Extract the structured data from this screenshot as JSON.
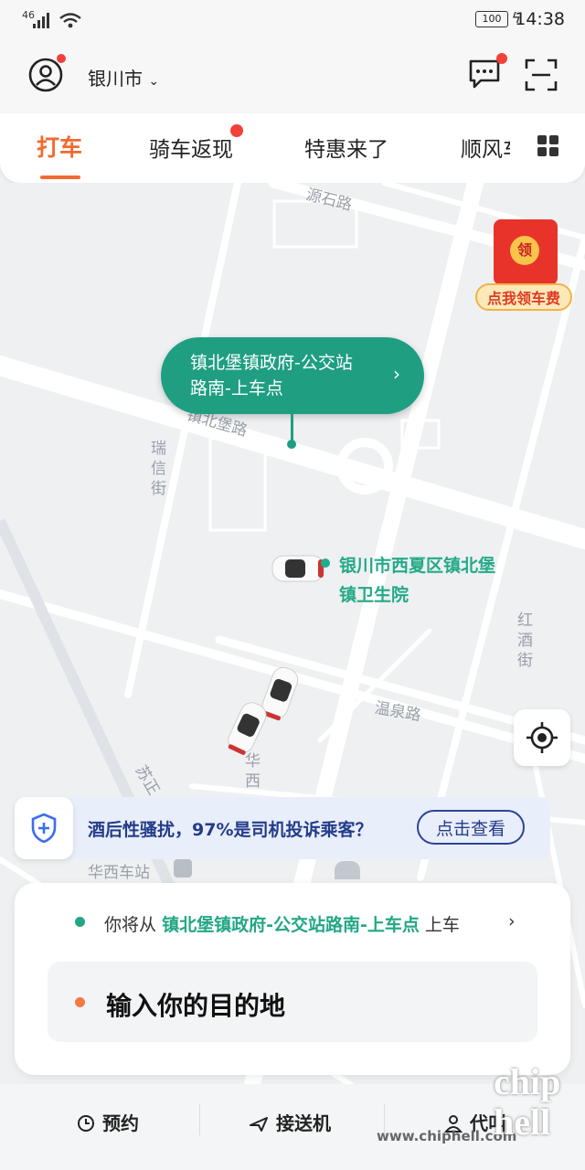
{
  "status_bar": {
    "network": "46",
    "battery": "100",
    "time": "14:38"
  },
  "header": {
    "city": "银川市"
  },
  "tabs": [
    {
      "label": "打车",
      "active": true
    },
    {
      "label": "骑车返现",
      "active": false
    },
    {
      "label": "特惠来了",
      "active": false
    },
    {
      "label": "顺风车",
      "active": false
    }
  ],
  "map": {
    "pickup_bubble": {
      "line1": "镇北堡镇政府-公交站",
      "line2": "路南-上车点"
    },
    "poi": {
      "line1": "银川市西夏区镇北堡",
      "line2": "镇卫生院"
    },
    "street_labels": {
      "s1": "源石路",
      "s2": "镇北堡路",
      "s3": "瑞信街",
      "s4": "红酒街",
      "s5": "温泉路",
      "s6": "华西",
      "s7": "苏正",
      "s8": "华西车站"
    },
    "red_packet": {
      "coin": "领",
      "label": "点我领车费"
    }
  },
  "banner": {
    "text": "酒后性骚扰，97%是司机投诉乘客？",
    "button": "点击查看"
  },
  "trip_card": {
    "from_prefix": "你将从",
    "pickup": "镇北堡镇政府-公交站路南-上车点",
    "from_suffix": "上车",
    "destination_placeholder": "输入你的目的地"
  },
  "bottom_nav": [
    {
      "label": "预约",
      "icon": "clock-icon"
    },
    {
      "label": "接送机",
      "icon": "plane-icon"
    },
    {
      "label": "代叫",
      "icon": "person-icon"
    }
  ],
  "watermark": {
    "url": "www.chiphell.com",
    "logo": "chip hell"
  },
  "colors": {
    "accent": "#f26a30",
    "green": "#1f9e82",
    "banner_blue": "#233c8a"
  }
}
